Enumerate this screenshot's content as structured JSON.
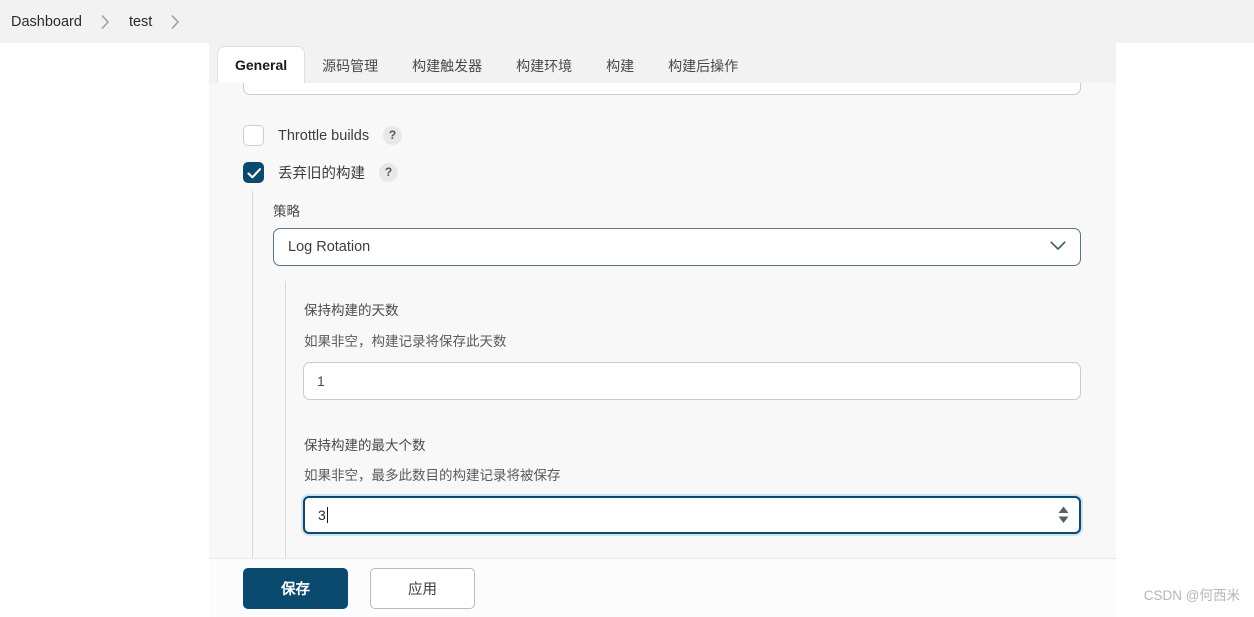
{
  "breadcrumb": {
    "items": [
      {
        "label": "Dashboard"
      },
      {
        "label": "test"
      }
    ],
    "separator_icon": "chevron-right-icon"
  },
  "tabs": [
    {
      "label": "General",
      "active": true
    },
    {
      "label": "源码管理",
      "active": false
    },
    {
      "label": "构建触发器",
      "active": false
    },
    {
      "label": "构建环境",
      "active": false
    },
    {
      "label": "构建",
      "active": false
    },
    {
      "label": "构建后操作",
      "active": false
    }
  ],
  "form": {
    "throttle": {
      "label": "Throttle builds",
      "checked": false,
      "help_icon": "question-mark-icon",
      "help_label": "?"
    },
    "discard_old_builds": {
      "label": "丢弃旧的构建",
      "checked": true,
      "help_icon": "question-mark-icon",
      "help_label": "?"
    },
    "strategy": {
      "label": "策略",
      "value": "Log Rotation",
      "options": [
        "Log Rotation"
      ],
      "chevron_icon": "chevron-down-icon"
    },
    "days_to_keep": {
      "label": "保持构建的天数",
      "description": "如果非空，构建记录将保存此天数",
      "value": "1"
    },
    "max_builds_to_keep": {
      "label": "保持构建的最大个数",
      "description": "如果非空，最多此数目的构建记录将被保存",
      "value": "3",
      "focused": true,
      "spinner_icon": "spinner-up-down-icon"
    }
  },
  "footer": {
    "save_label": "保存",
    "apply_label": "应用"
  },
  "watermark": {
    "text": "CSDN @何西米"
  },
  "colors": {
    "accent": "#0b4a6f",
    "page_bg": "#ffffff",
    "chrome_bg": "#f2f2f2",
    "form_bg": "#f8f8f8",
    "border": "#c3ccd4",
    "focus_ring": "#cfe2f0"
  }
}
